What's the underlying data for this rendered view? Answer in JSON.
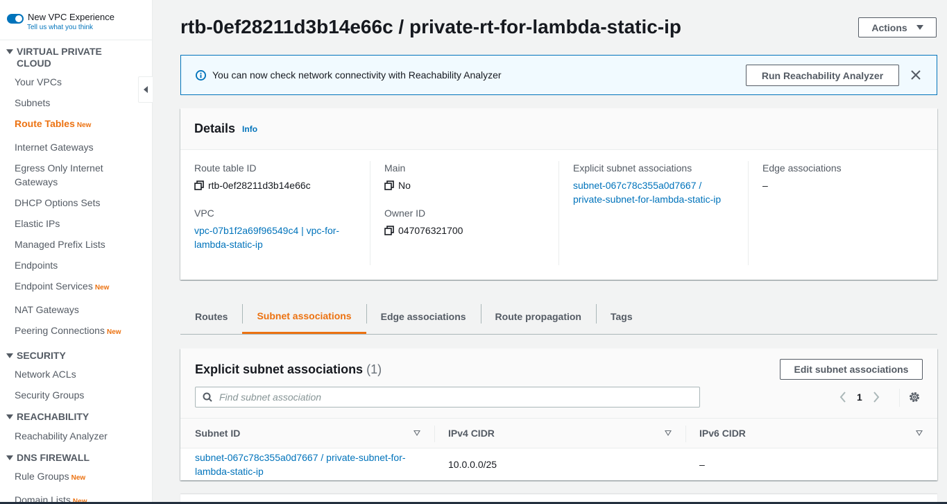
{
  "sidebar": {
    "experience_toggle": {
      "title": "New VPC Experience",
      "subtitle": "Tell us what you think"
    },
    "sections": {
      "vpc": "VIRTUAL PRIVATE CLOUD",
      "security": "SECURITY",
      "reachability": "REACHABILITY",
      "dns_firewall": "DNS FIREWALL"
    },
    "items": {
      "your_vpcs": "Your VPCs",
      "subnets": "Subnets",
      "route_tables": "Route Tables",
      "internet_gateways": "Internet Gateways",
      "egress_only": "Egress Only Internet Gateways",
      "dhcp": "DHCP Options Sets",
      "elastic_ips": "Elastic IPs",
      "prefix_lists": "Managed Prefix Lists",
      "endpoints": "Endpoints",
      "endpoint_services": "Endpoint Services",
      "nat_gateways": "NAT Gateways",
      "peering": "Peering Connections",
      "network_acls": "Network ACLs",
      "security_groups": "Security Groups",
      "reachability_analyzer": "Reachability Analyzer",
      "rule_groups": "Rule Groups",
      "domain_lists": "Domain Lists"
    },
    "new_badge": "New"
  },
  "page": {
    "title": "rtb-0ef28211d3b14e66c / private-rt-for-lambda-static-ip",
    "actions_label": "Actions"
  },
  "flash": {
    "message": "You can now check network connectivity with Reachability Analyzer",
    "button_label": "Run Reachability Analyzer"
  },
  "details": {
    "title": "Details",
    "info_label": "Info",
    "route_table_id": {
      "label": "Route table ID",
      "value": "rtb-0ef28211d3b14e66c"
    },
    "vpc": {
      "label": "VPC",
      "value_line1": "vpc-07b1f2a69f96549c4 | vpc-for-",
      "value_line2": "lambda-static-ip"
    },
    "main": {
      "label": "Main",
      "value": "No"
    },
    "owner_id": {
      "label": "Owner ID",
      "value": "047076321700"
    },
    "explicit_subnet": {
      "label": "Explicit subnet associations",
      "value_line1": "subnet-067c78c355a0d7667 /",
      "value_line2": "private-subnet-for-lambda-static-ip"
    },
    "edge": {
      "label": "Edge associations",
      "value": "–"
    }
  },
  "tabs": [
    "Routes",
    "Subnet associations",
    "Edge associations",
    "Route propagation",
    "Tags"
  ],
  "assoc": {
    "title": "Explicit subnet associations",
    "count": "(1)",
    "edit_label": "Edit subnet associations",
    "search_placeholder": "Find subnet association",
    "page_number": "1",
    "columns": [
      "Subnet ID",
      "IPv4 CIDR",
      "IPv6 CIDR"
    ],
    "rows": [
      {
        "subnet_line1": "subnet-067c78c355a0d7667 / private-subnet-for-",
        "subnet_line2": "lambda-static-ip",
        "ipv4": "10.0.0.0/25",
        "ipv6": "–"
      }
    ]
  },
  "colors": {
    "accent": "#ec7211",
    "link": "#0073bb",
    "info_bg": "#f1faff"
  },
  "icons": [
    "info-icon",
    "close-icon",
    "copy-icon",
    "search-icon",
    "chevron-left-icon",
    "chevron-right-icon",
    "gear-icon",
    "sort-icon",
    "caret-down-icon"
  ]
}
